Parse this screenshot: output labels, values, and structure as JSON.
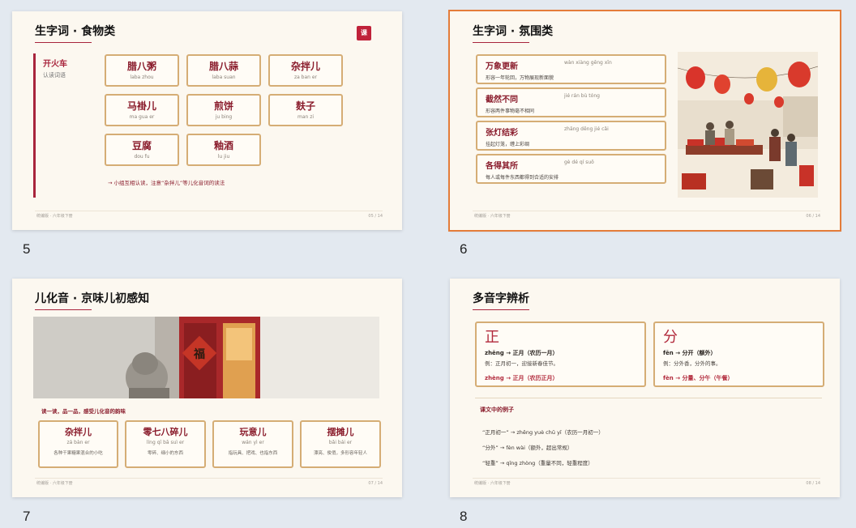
{
  "slides": [
    {
      "number": "5",
      "title": "生字词 · 食物类",
      "badge": "课",
      "side_title": "开火车",
      "side_sub": "认读词语",
      "words": [
        {
          "hz": "腊八粥",
          "py": "laba zhou"
        },
        {
          "hz": "腊八蒜",
          "py": "laba suan"
        },
        {
          "hz": "杂拌儿",
          "py": "za ban er"
        },
        {
          "hz": "马褂儿",
          "py": "ma gua er"
        },
        {
          "hz": "煎饼",
          "py": "ju bing"
        },
        {
          "hz": "麸子",
          "py": "man zi"
        },
        {
          "hz": "豆腐",
          "py": "dou fu"
        },
        {
          "hz": "釉酒",
          "py": "lu jiu"
        }
      ],
      "note": "→ 小组互相认读，注意“杂拌儿”等儿化音词的读法",
      "footer_left": "统编版 · 六年级下册",
      "footer_right": "05 / 14"
    },
    {
      "number": "6",
      "title": "生字词 · 氛围类",
      "idioms": [
        {
          "hz": "万象更新",
          "py": "wàn xiàng gēng xīn",
          "desc": "形容一年轮回，万物展现新面貌"
        },
        {
          "hz": "截然不同",
          "py": "jié rán bù tóng",
          "desc": "形容两件事物毫不相同"
        },
        {
          "hz": "张灯结彩",
          "py": "zhāng dēng jié cǎi",
          "desc": "挂起灯笼，缠上彩绸"
        },
        {
          "hz": "各得其所",
          "py": "gè dé qí suǒ",
          "desc": "每人或每件东西都得到合适的安排"
        }
      ],
      "footer_left": "统编版 · 六年级下册",
      "footer_right": "06 / 14"
    },
    {
      "number": "7",
      "title": "儿化音 · 京味儿初感知",
      "door_char": "福",
      "caption": "读一读，品一品，感受儿化音的韵味",
      "cards": [
        {
          "hz": "杂拌儿",
          "py": "zá bàn er",
          "desc": "各种干果糖果混合的小吃"
        },
        {
          "hz": "零七八碎儿",
          "py": "líng qī bā suì er",
          "desc": "零碎、细小的东西"
        },
        {
          "hz": "玩意儿",
          "py": "wán yì er",
          "desc": "指玩具、把戏、也指东西"
        },
        {
          "hz": "摆摊儿",
          "py": "bǎi bái er",
          "desc": "漂亮、俊俏，多形容年轻人"
        }
      ],
      "footer_left": "统编版 · 六年级下册",
      "footer_right": "07 / 14"
    },
    {
      "number": "8",
      "title": "多音字辨析",
      "cards": [
        {
          "char": "正",
          "line1": "zhēng → 正月（农历一月）",
          "line2": "例：正月初一，迎接新春佳节。",
          "line3": "zhèng → 正月（农历正月）"
        },
        {
          "char": "分",
          "line1": "fēn → 分开（额外）",
          "line2": "例：分外香，分外的事。",
          "line3": "fèn → 分量、分午（午餐）"
        }
      ],
      "examples_title": "课文中的例子",
      "examples": [
        "“正月初一” → zhēng yuè chū yī（农历一月初一）",
        "“分外” → fèn wài（额外，超出常规）",
        "“轻重” → qīng zhòng（重量不同，轻重程度）"
      ],
      "footer_left": "统编版 · 六年级下册",
      "footer_right": "08 / 14"
    }
  ],
  "colors": {
    "accent": "#a8243c",
    "card_border": "#d5ad75",
    "selected_outline": "#e47c3a",
    "background": "#e3e9f0"
  }
}
